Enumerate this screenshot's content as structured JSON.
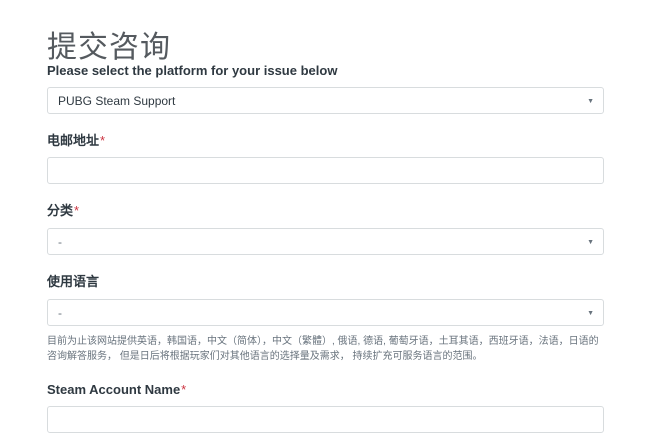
{
  "page_title": "提交咨询",
  "platform": {
    "label": "Please select the platform for your issue below",
    "selected": "PUBG Steam Support"
  },
  "email": {
    "label": "电邮地址",
    "required_mark": "*",
    "value": ""
  },
  "category": {
    "label": "分类",
    "required_mark": "*",
    "selected": "-"
  },
  "language": {
    "label": "使用语言",
    "selected": "-",
    "hint": "目前为止该网站提供英语，韩国语，中文（简体），中文（繁體）, 俄语, 德语, 葡萄牙语，土耳其语，西班牙语，法语，日语的咨询解答服务， 但是日后将根据玩家们对其他语言的选择量及需求， 持续扩充可服务语言的范围。"
  },
  "steam_account": {
    "label": "Steam Account Name",
    "required_mark": "*",
    "value": ""
  },
  "icons": {
    "chevron": "chevron-down-icon"
  },
  "colors": {
    "required": "#cc3340",
    "border": "#d8dcde",
    "text": "#2f3941",
    "muted": "#68737d"
  }
}
